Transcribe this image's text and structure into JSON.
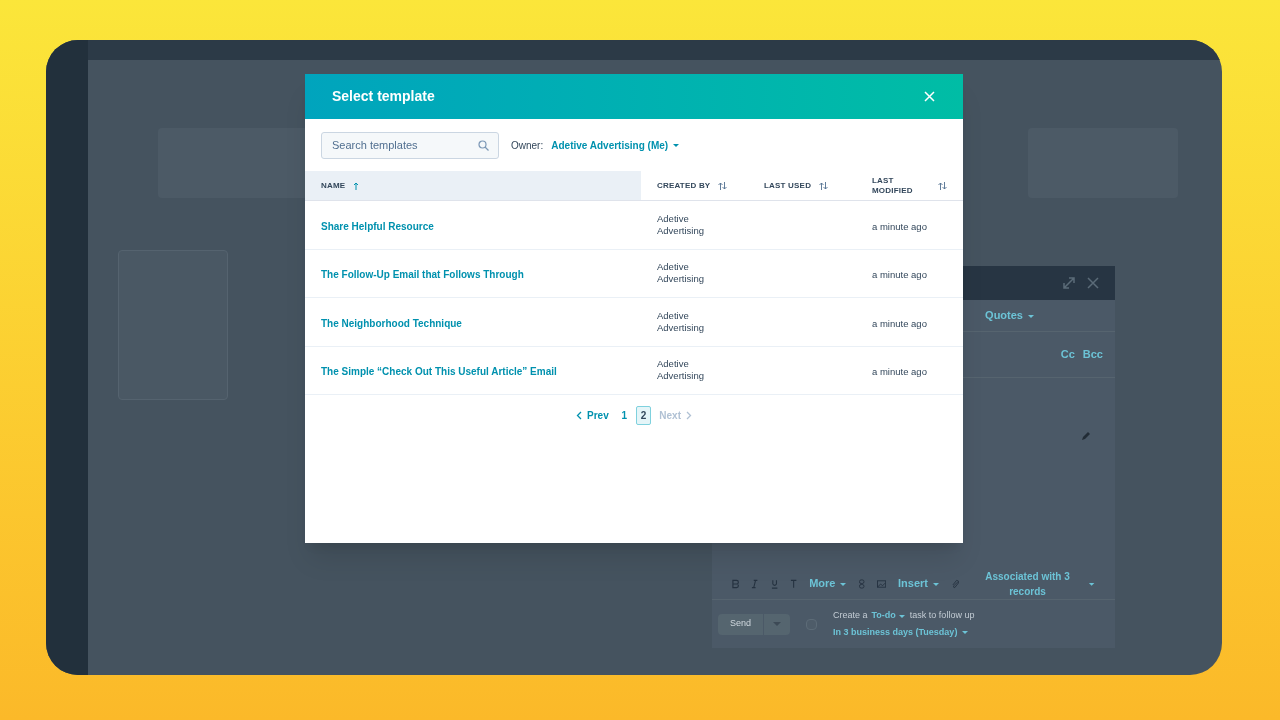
{
  "modal": {
    "title": "Select template",
    "search": {
      "placeholder": "Search templates"
    },
    "owner": {
      "label": "Owner:",
      "value": "Adetive Advertising (Me)"
    },
    "table": {
      "columns": [
        {
          "label": "NAME",
          "sorted": true
        },
        {
          "label": "CREATED BY",
          "sorted": false
        },
        {
          "label": "LAST USED",
          "sorted": false
        },
        {
          "label": "LAST MODIFIED",
          "sorted": false
        }
      ],
      "rows": [
        {
          "name": "Share Helpful Resource",
          "created_by": "Adetive Advertising",
          "last_modified": "a minute ago"
        },
        {
          "name": "The Follow-Up Email that Follows Through",
          "created_by": "Adetive Advertising",
          "last_modified": "a minute ago"
        },
        {
          "name": "The Neighborhood Technique",
          "created_by": "Adetive Advertising",
          "last_modified": "a minute ago"
        },
        {
          "name": "The Simple “Check Out This Useful Article” Email",
          "created_by": "Adetive Advertising",
          "last_modified": "a minute ago"
        }
      ]
    },
    "pagination": {
      "prev": {
        "label": "Prev",
        "disabled": false
      },
      "pages": [
        {
          "label": "1",
          "selected": false
        },
        {
          "label": "2",
          "selected": true
        }
      ],
      "next": {
        "label": "Next",
        "disabled": true
      }
    }
  },
  "background_composer": {
    "toolbar_menu": "Quotes",
    "recipients_links": [
      "Cc",
      "Bcc"
    ],
    "format_toolbar": {
      "more": "More",
      "insert": "Insert",
      "associations": "Associated with 3 records"
    },
    "footer": {
      "send": "Send",
      "task_prefix": "Create a",
      "task_type": "To-do",
      "task_suffix": "task to follow up",
      "due": "In 3 business days (Tuesday)",
      "checked": false
    }
  }
}
